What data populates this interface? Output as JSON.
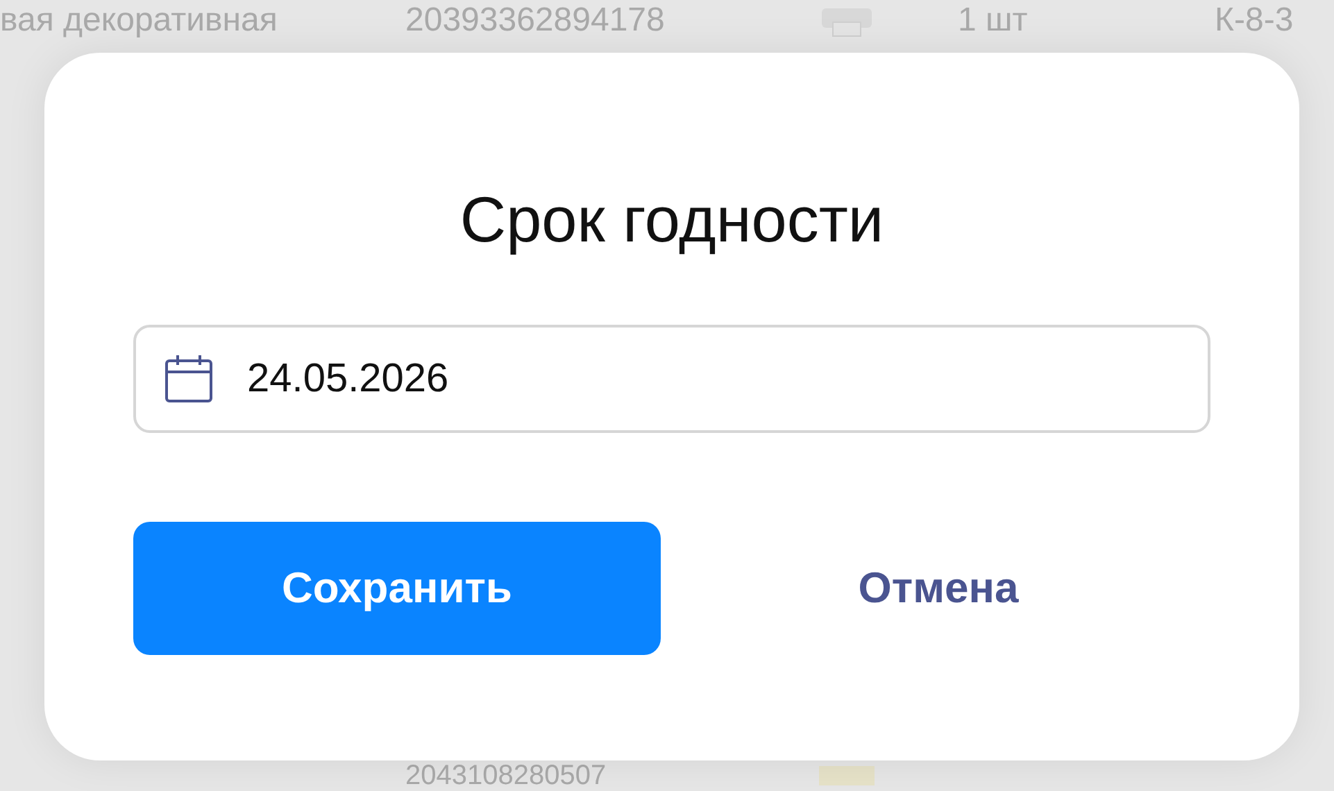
{
  "background": {
    "top_row": {
      "name": "вая декоративная",
      "barcode": "20393362894178",
      "quantity": "1 шт",
      "cell": "К-8-3"
    },
    "bottom_row": {
      "barcode": "2043108280507"
    }
  },
  "dialog": {
    "title": "Срок годности",
    "date_field": {
      "value": "24.05.2026"
    },
    "buttons": [
      {
        "label": "Сохранить",
        "kind": "primary"
      },
      {
        "label": "Отмена",
        "kind": "secondary"
      }
    ]
  }
}
